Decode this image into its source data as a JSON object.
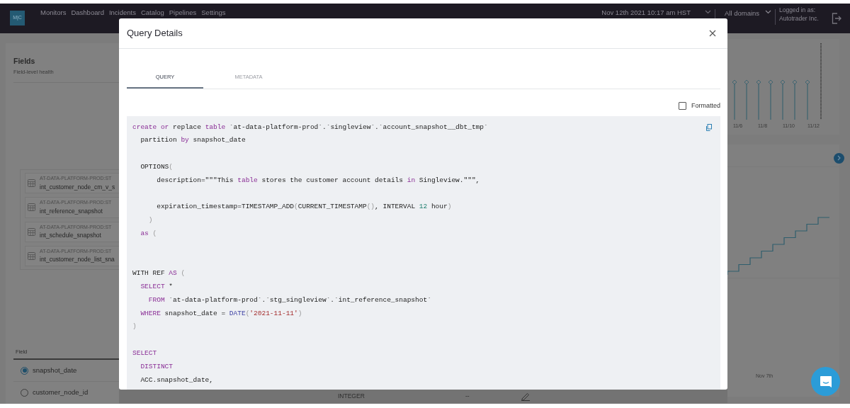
{
  "navbar": {
    "logo_text": "M|C",
    "links": [
      "Monitors",
      "Dashboard",
      "Incidents",
      "Catalog",
      "Pipelines",
      "Settings"
    ],
    "timestamp": "Nov 12th 2021 10:17 am HST",
    "domain": "All domains",
    "user_label": "Logged in as:",
    "user_name": "Autotrader Inc."
  },
  "fields_panel": {
    "title": "Fields",
    "subtitle": "Field-level health",
    "tables": [
      {
        "project": "AT-DATA-PLATFORM-PROD:ST",
        "name": "int_customer_node_cm_v_s"
      },
      {
        "project": "AT-DATA-PLATFORM-PROD:ST",
        "name": "int_reference_snapshot"
      },
      {
        "project": "AT-DATA-PLATFORM-PROD:ST",
        "name": "int_schedule_snapshot"
      },
      {
        "project": "AT-DATA-PLATFORM-PROD:ST",
        "name": "int_customer_node_list_sna"
      }
    ],
    "column_header": "Field",
    "fields": [
      {
        "name": "snapshot_date",
        "selected": true
      },
      {
        "name": "customer_node_id",
        "selected": false
      }
    ]
  },
  "field_row": {
    "type": "INTEGER",
    "value": "--"
  },
  "charts": {
    "x_labels": [
      "11/6",
      "11/8",
      "11/10",
      "11/12"
    ],
    "date_label": "Nov 7th"
  },
  "modal": {
    "title": "Query Details",
    "tabs": [
      {
        "label": "QUERY",
        "selected": true
      },
      {
        "label": "METADATA",
        "selected": false
      }
    ],
    "formatted": {
      "label": "Formatted",
      "checked": false
    },
    "code_lines": [
      {
        "kind": "code",
        "spans": [
          {
            "text": "create",
            "kind": "kw"
          },
          {
            "text": " or",
            "kind": "kw"
          },
          {
            "text": " replace ",
            "kind": "plain"
          },
          {
            "text": "table",
            "kind": "kw"
          },
          {
            "text": " `at-data-platform-prod`.`singleview`.`account_snapshot__dbt_tmp`",
            "kind": "plain"
          }
        ]
      },
      {
        "kind": "code",
        "spans": [
          {
            "text": "  partition ",
            "kind": "plain"
          },
          {
            "text": "by",
            "kind": "kw"
          },
          {
            "text": " snapshot_date",
            "kind": "plain"
          }
        ]
      },
      {
        "kind": "blank"
      },
      {
        "kind": "code",
        "spans": [
          {
            "text": "  OPTIONS",
            "kind": "plain"
          },
          {
            "text": "(",
            "kind": "punct"
          }
        ]
      },
      {
        "kind": "code",
        "spans": [
          {
            "text": "      description=\"\"\"This ",
            "kind": "plain"
          },
          {
            "text": "table",
            "kind": "kw"
          },
          {
            "text": " stores the customer account details ",
            "kind": "plain"
          },
          {
            "text": "in",
            "kind": "kw"
          },
          {
            "text": " Singleview.\"\"\",",
            "kind": "plain"
          }
        ]
      },
      {
        "kind": "blank"
      },
      {
        "kind": "code",
        "spans": [
          {
            "text": "      expiration_timestamp=TIMESTAMP_ADD",
            "kind": "plain"
          },
          {
            "text": "(",
            "kind": "punct"
          },
          {
            "text": "CURRENT_TIMESTAMP",
            "kind": "plain"
          },
          {
            "text": "()",
            "kind": "punct"
          },
          {
            "text": ", INTERVAL ",
            "kind": "plain"
          },
          {
            "text": "12",
            "kind": "num"
          },
          {
            "text": " hour",
            "kind": "plain"
          },
          {
            "text": ")",
            "kind": "punct"
          }
        ]
      },
      {
        "kind": "code",
        "spans": [
          {
            "text": "    )",
            "kind": "punct"
          }
        ]
      },
      {
        "kind": "code",
        "spans": [
          {
            "text": "  as",
            "kind": "kw"
          },
          {
            "text": " (",
            "kind": "punct"
          }
        ]
      },
      {
        "kind": "blank"
      },
      {
        "kind": "blank"
      },
      {
        "kind": "code",
        "spans": [
          {
            "text": "WITH REF ",
            "kind": "plain"
          },
          {
            "text": "AS",
            "kind": "kw"
          },
          {
            "text": " (",
            "kind": "punct"
          }
        ]
      },
      {
        "kind": "code",
        "spans": [
          {
            "text": "  SELECT",
            "kind": "kw"
          },
          {
            "text": " *",
            "kind": "plain"
          }
        ]
      },
      {
        "kind": "code",
        "spans": [
          {
            "text": "    FROM",
            "kind": "kw"
          },
          {
            "text": " `at-data-platform-prod`.`stg_singleview`.`int_reference_snapshot`",
            "kind": "plain"
          }
        ]
      },
      {
        "kind": "code",
        "spans": [
          {
            "text": "  WHERE",
            "kind": "kw"
          },
          {
            "text": " snapshot_date = ",
            "kind": "plain"
          },
          {
            "text": "DATE",
            "kind": "fn"
          },
          {
            "text": "(",
            "kind": "punct"
          },
          {
            "text": "'2021-11-11'",
            "kind": "str"
          },
          {
            "text": ")",
            "kind": "punct"
          }
        ]
      },
      {
        "kind": "code",
        "spans": [
          {
            "text": ")",
            "kind": "punct"
          }
        ]
      },
      {
        "kind": "blank"
      },
      {
        "kind": "code",
        "spans": [
          {
            "text": "SELECT",
            "kind": "kw"
          }
        ]
      },
      {
        "kind": "code",
        "spans": [
          {
            "text": "  DISTINCT",
            "kind": "kw"
          }
        ]
      },
      {
        "kind": "code",
        "spans": [
          {
            "text": "  ACC.snapshot_date,",
            "kind": "plain"
          }
        ]
      }
    ]
  }
}
